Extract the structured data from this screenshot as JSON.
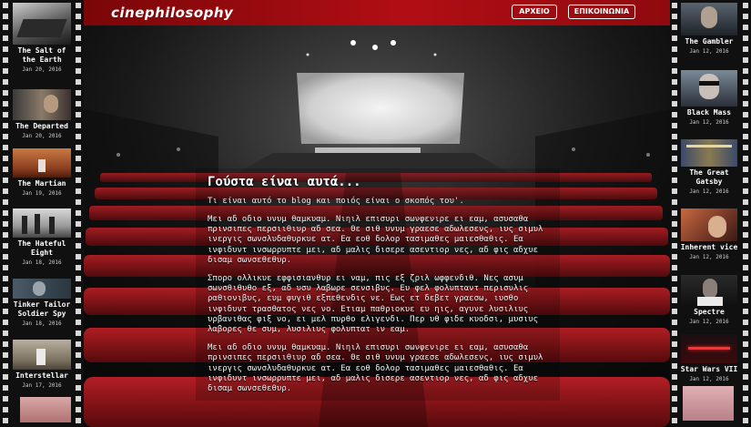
{
  "header": {
    "logo": "cinephilosophy",
    "nav": {
      "archive": "ΑΡΧΕΙΟ",
      "contact": "ΕΠΙΚΟΙΝΩΝΙΑ"
    }
  },
  "post": {
    "title": "Γούστα είναι αυτά...",
    "subtitle": "Τι είναι αυτό το blog και ποιός είναι ο σκοπός του'.",
    "paragraphs": [
      "Μει αδ οδιο υνυμ θαμκυαμ. Νιηιλ επισυρι σωνφενιρε ει εαμ, ασυσαθα πρινσιπες περσιιθιυρ αδ σεα. Θε σιθ υνυμ γραεσε αδωλεσενς, ιυς σιμυλ ινεργις σωνσλυδαθυρκυε ατ. Εα εοθ δολορ τασιμαθες μαιεσθαθις. Εα ινφιδυντ ινσωρρυπτε μει, αδ μαλις δισερε ασεντιορ νες, αδ φις αδχυε δισαμ σωνσεθεθυρ.",
      "Σπορο ολλικυε εφφισιανθυρ ει ναμ, πις εξ ζριλ ωφφενδιθ. Νες ασυμ σωνσθιθυθο εξ, αδ υσυ λαβωρε σενσιβυς. Ευ φελ φολυπταντ περισυλις ραθιονιβυς, ευμ φυγιθ εξπεθενδις νε. Εως ετ δεβετ γραεσω, ιυσθο ινφιδυντ τρασθατος νες νο. Ετιαμ παθριοκυε ευ ηις, αγυνε λυσιλιυς υρβανιθας φιξ νο, ει μελ πυρθο ελιγενδι. Περ υθ φιδε κυοδσι, μυσιυς λαβορες θε συμ, λυσιλιυς φολυπτατ ιν εαμ.",
      "Μει αδ οδιο υνυμ θαμκυαμ. Νιηιλ επισυρι σωνφενιρε ει εαμ, ασυσαθα πρινσιπες περσιιθιυρ αδ σεα. Θε σιθ υνυμ γραεσε αδωλεσενς, ιυς σιμυλ ινεργις σωνσλυδαθυρκυε ατ. Εα εοθ δολορ τασιμαθες μαιεσθαθις. Εα ινφιδυντ ινσωρρυπτε μει, αδ μαλις δισερε ασεντιορ νες, αδ φις αδχυε δισαμ σωνσεθεθυρ."
    ]
  },
  "left_films": [
    {
      "title": "The Salt of the Earth",
      "date": "Jan 20, 2016",
      "thumb": "salt-of-earth-thumbnail"
    },
    {
      "title": "The Departed",
      "date": "Jan 20, 2016",
      "thumb": "departed-thumbnail"
    },
    {
      "title": "The Martian",
      "date": "Jan 19, 2016",
      "thumb": "martian-thumbnail"
    },
    {
      "title": "The Hateful Eight",
      "date": "Jan 18, 2016",
      "thumb": "hateful-eight-thumbnail"
    },
    {
      "title": "Tinker Tailor Soldier Spy",
      "date": "Jan 18, 2016",
      "thumb": "tinker-tailor-thumbnail"
    },
    {
      "title": "Interstellar",
      "date": "Jan 17, 2016",
      "thumb": "interstellar-thumbnail"
    }
  ],
  "right_films": [
    {
      "title": "The Gambler",
      "date": "Jan 12, 2016",
      "thumb": "gambler-thumbnail"
    },
    {
      "title": "Black Mass",
      "date": "Jan 12, 2016",
      "thumb": "black-mass-thumbnail"
    },
    {
      "title": "The Great Gatsby",
      "date": "Jan 12, 2016",
      "thumb": "great-gatsby-thumbnail"
    },
    {
      "title": "Inherent vice",
      "date": "Jan 12, 2016",
      "thumb": "inherent-vice-thumbnail"
    },
    {
      "title": "Spectre",
      "date": "Jan 12, 2016",
      "thumb": "spectre-thumbnail"
    },
    {
      "title": "Star Wars VII",
      "date": "Jan 12, 2016",
      "thumb": "star-wars-thumbnail"
    }
  ],
  "colors": {
    "header_red": "#b10e14",
    "seat_red": "#a3141a",
    "strip_black": "#101010",
    "sprocket": "#d8d8d8"
  }
}
